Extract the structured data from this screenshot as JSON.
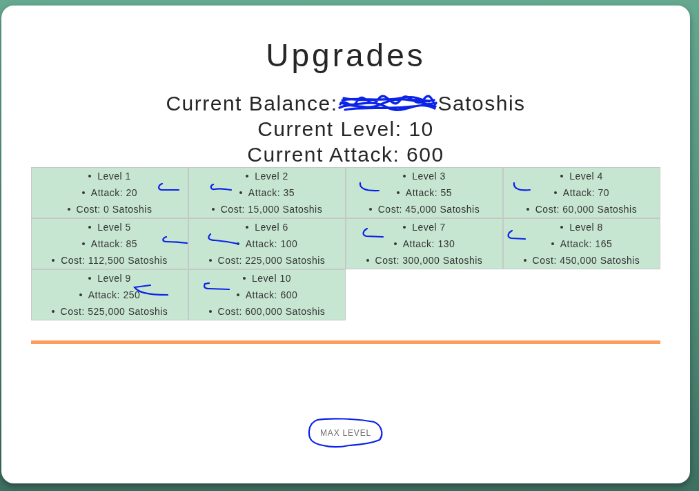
{
  "title": "Upgrades",
  "balance": {
    "label": "Current Balance:",
    "redacted": true,
    "unit": "Satoshis"
  },
  "current_level": "Current Level: 10",
  "current_attack": "Current Attack: 600",
  "levels": [
    {
      "level": "Level 1",
      "attack": "Attack: 20",
      "cost": "Cost: 0 Satoshis",
      "pen_mark": true
    },
    {
      "level": "Level 2",
      "attack": "Attack: 35",
      "cost": "Cost: 15,000 Satoshis",
      "pen_mark": true
    },
    {
      "level": "Level 3",
      "attack": "Attack: 55",
      "cost": "Cost: 45,000 Satoshis",
      "pen_mark": true
    },
    {
      "level": "Level 4",
      "attack": "Attack: 70",
      "cost": "Cost: 60,000 Satoshis",
      "pen_mark": true
    },
    {
      "level": "Level 5",
      "attack": "Attack: 85",
      "cost": "Cost: 112,500 Satoshis",
      "pen_mark": true
    },
    {
      "level": "Level 6",
      "attack": "Attack: 100",
      "cost": "Cost: 225,000 Satoshis",
      "pen_mark": true
    },
    {
      "level": "Level 7",
      "attack": "Attack: 130",
      "cost": "Cost: 300,000 Satoshis",
      "pen_mark": true
    },
    {
      "level": "Level 8",
      "attack": "Attack: 165",
      "cost": "Cost: 450,000 Satoshis",
      "pen_mark": true
    },
    {
      "level": "Level 9",
      "attack": "Attack: 250",
      "cost": "Cost: 525,000 Satoshis",
      "pen_mark": true
    },
    {
      "level": "Level 10",
      "attack": "Attack: 600",
      "cost": "Cost: 600,000 Satoshis",
      "pen_mark": true
    }
  ],
  "max_button": {
    "label": "MAX LEVEL",
    "disabled": true,
    "circled": true
  }
}
